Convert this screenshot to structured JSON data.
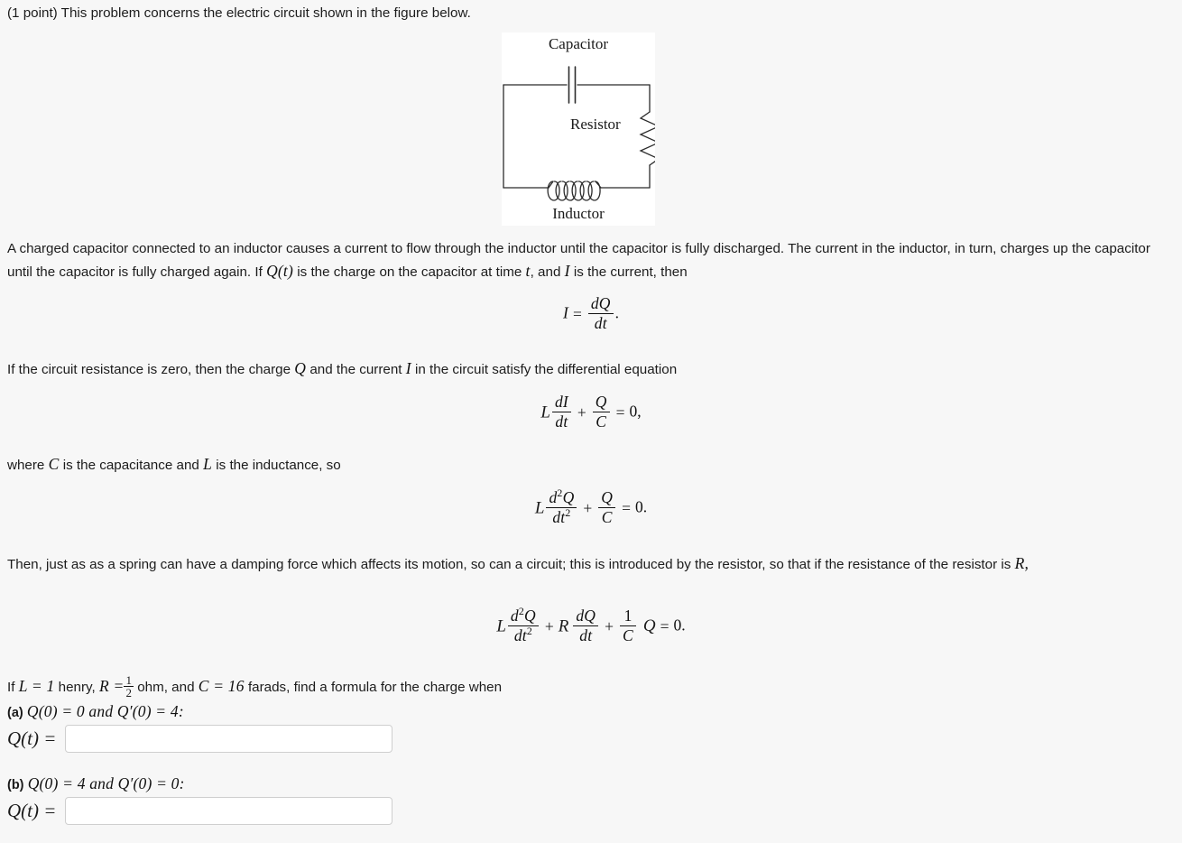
{
  "header": {
    "points_prefix": "(1 point)",
    "intro": "This problem concerns the electric circuit shown in the figure below."
  },
  "figure": {
    "name": "electric-circuit-diagram",
    "capacitor_label": "Capacitor",
    "resistor_label": "Resistor",
    "inductor_label": "Inductor",
    "background": "#ffffff",
    "stroke": "#2b2b2b"
  },
  "body": {
    "para1_a": "A charged capacitor connected to an inductor causes a current to flow through the inductor until the capacitor is fully discharged. The current in the inductor, in turn, charges up the capacitor until the capacitor is fully charged again. If",
    "para1_q": "Q(t)",
    "para1_b": "is the charge on the capacitor at time",
    "para1_t": "t",
    "para1_c": ", and",
    "para1_i": "I",
    "para1_d": "is the current, then",
    "para2_a": "If the circuit resistance is zero, then the charge",
    "para2_q": "Q",
    "para2_b": "and the current",
    "para2_i": "I",
    "para2_c": "in the circuit satisfy the differential equation",
    "para3_a": "where",
    "para3_c": "C",
    "para3_b": "is the capacitance and",
    "para3_l": "L",
    "para3_d": "is the inductance, so",
    "para4_a": "Then, just as as a spring can have a damping force which affects its motion, so can a circuit; this is introduced by the resistor, so that if the resistance of the resistor is",
    "para4_r": "R,"
  },
  "equations": {
    "eq1": {
      "lhs": "I",
      "eq": "=",
      "num": "dQ",
      "den": "dt",
      "tail": "."
    },
    "eq2": {
      "coef": "L",
      "num": "dI",
      "den": "dt",
      "plus": "+",
      "num2": "Q",
      "den2": "C",
      "eq": "=",
      "rhs": "0,"
    },
    "eq3": {
      "coef": "L",
      "num": "d²Q",
      "num_base": "d",
      "num_exp": "2",
      "num_var": "Q",
      "den": "dt",
      "den_exp": "2",
      "plus": "+",
      "num2": "Q",
      "den2": "C",
      "eq": "=",
      "rhs": "0."
    },
    "eq4": {
      "coef": "L",
      "num_base": "d",
      "num_exp": "2",
      "num_var": "Q",
      "den": "dt",
      "den_exp": "2",
      "plus1": "+",
      "coefR": "R",
      "num2": "dQ",
      "den2": "dt",
      "plus2": "+",
      "num3": "1",
      "den3": "C",
      "var": "Q",
      "eq": "=",
      "rhs": "0."
    }
  },
  "question": {
    "given_a": "If",
    "given_L": "L = 1",
    "given_henry": "henry,",
    "given_R": "R =",
    "given_R_num": "1",
    "given_R_den": "2",
    "given_ohm": "ohm, and",
    "given_C": "C = 16",
    "given_farads": "farads, find a formula for the charge when",
    "parts": [
      {
        "tag": "(a)",
        "conditions": "Q(0) = 0 and Q′(0) = 4:",
        "answer_lhs": "Q(t) =",
        "answer_value": "",
        "answer_placeholder": ""
      },
      {
        "tag": "(b)",
        "conditions": "Q(0) = 4 and Q′(0) = 0:",
        "answer_lhs": "Q(t) =",
        "answer_value": "",
        "answer_placeholder": ""
      }
    ]
  }
}
